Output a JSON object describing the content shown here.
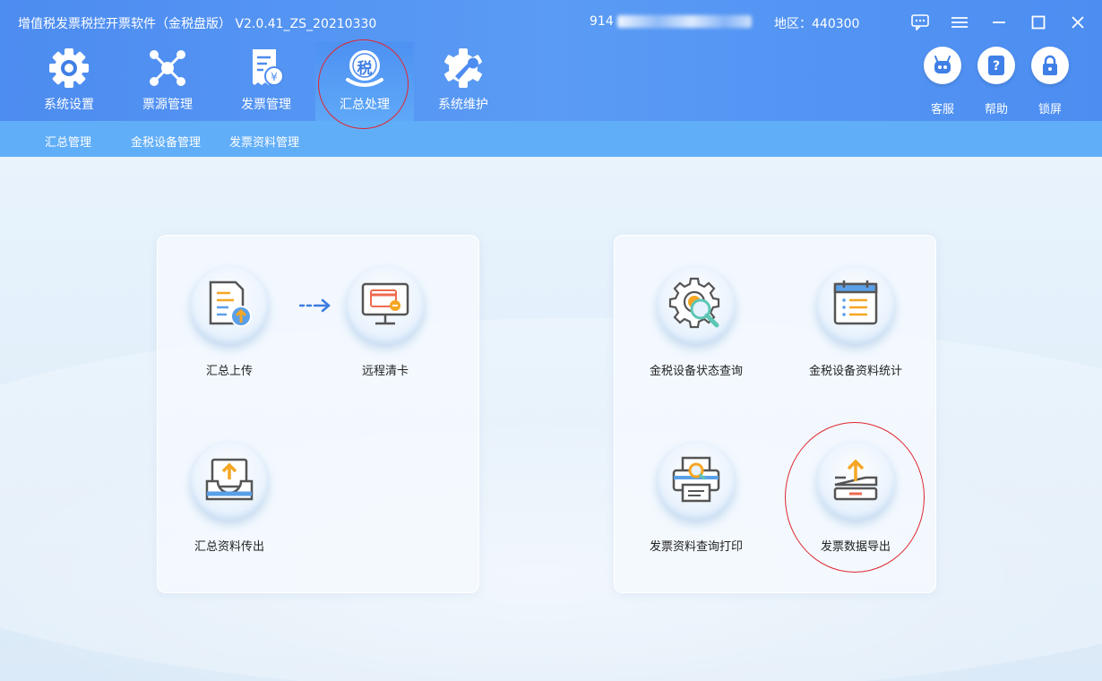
{
  "app": {
    "title": "增值税发票税控开票软件（金税盘版） V2.0.41_ZS_20210330",
    "tax_id_prefix": "914",
    "region": "地区：440300"
  },
  "window_controls": [
    "chat-icon",
    "menu-icon",
    "minimize-icon",
    "maximize-icon",
    "close-icon"
  ],
  "nav": {
    "items": [
      {
        "label": "系统设置",
        "icon": "gear-icon",
        "active": false
      },
      {
        "label": "票源管理",
        "icon": "network-icon",
        "active": false
      },
      {
        "label": "发票管理",
        "icon": "invoice-icon",
        "active": false
      },
      {
        "label": "汇总处理",
        "icon": "tax-summary-icon",
        "active": true,
        "icon_text": "税"
      },
      {
        "label": "系统维护",
        "icon": "maintenance-icon",
        "active": false
      }
    ]
  },
  "tools": [
    {
      "label": "客服",
      "icon": "robot-icon"
    },
    {
      "label": "帮助",
      "icon": "help-book-icon"
    },
    {
      "label": "锁屏",
      "icon": "lock-icon"
    }
  ],
  "subtabs": [
    "汇总管理",
    "金税设备管理",
    "发票资料管理"
  ],
  "panels": {
    "left": {
      "functions": [
        {
          "label": "汇总上传",
          "icon": "upload-document-icon"
        },
        {
          "label": "远程清卡",
          "icon": "remote-clear-card-icon"
        },
        {
          "label": "汇总资料传出",
          "icon": "export-tray-icon"
        }
      ]
    },
    "right": {
      "functions": [
        {
          "label": "金税设备状态查询",
          "icon": "gear-search-icon"
        },
        {
          "label": "金税设备资料统计",
          "icon": "calendar-list-icon"
        },
        {
          "label": "发票资料查询打印",
          "icon": "printer-search-icon"
        },
        {
          "label": "发票数据导出",
          "icon": "data-export-icon"
        }
      ]
    }
  },
  "colors": {
    "header_blue": "#4d8cf0",
    "subbar_blue": "#61aef8",
    "annotation_red": "#e0262f",
    "accent_orange": "#f5a623"
  }
}
